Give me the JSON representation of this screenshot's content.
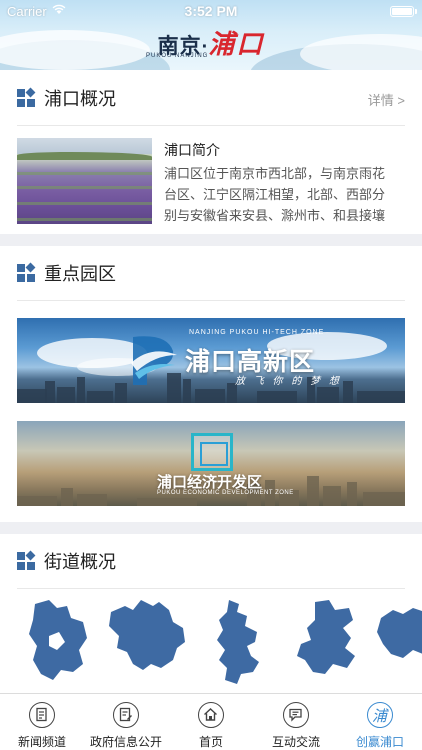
{
  "status_bar": {
    "carrier": "Carrier",
    "time": "3:52 PM"
  },
  "header": {
    "logo_city": "南京",
    "logo_dot": "·",
    "logo_district": "浦口",
    "logo_pinyin": "PUKOU NANJING"
  },
  "overview": {
    "title": "浦口概况",
    "more": "详情 >",
    "intro_title": "浦口简介",
    "intro_text": "浦口区位于南京市西北部，与南京雨花台区、江宁区隔江相望，北部、西部分别与安徽省来安县、滁州市、和县接壤"
  },
  "parks": {
    "title": "重点园区",
    "banners": [
      {
        "name": "浦口高新区",
        "sub": "NANJING PUKOU HI-TECH ZONE",
        "slogan": "放 飞 你 的 梦 想"
      },
      {
        "name": "浦口经济开发区",
        "sub": "PUKOU ECONOMIC DEVELOPMENT ZONE"
      }
    ]
  },
  "streets": {
    "title": "街道概况"
  },
  "tabbar": {
    "items": [
      {
        "label": "新闻频道",
        "icon": "news-icon"
      },
      {
        "label": "政府信息公开",
        "icon": "document-icon"
      },
      {
        "label": "首页",
        "icon": "home-icon"
      },
      {
        "label": "互动交流",
        "icon": "chat-icon"
      },
      {
        "label": "创赢浦口",
        "icon": "pukou-icon",
        "glyph": "浦",
        "active": true
      }
    ]
  },
  "colors": {
    "accent": "#3a8ad0",
    "section_icon": "#3b6aa1",
    "map_fill": "#3e6aa3",
    "logo_red": "#d9262e"
  }
}
